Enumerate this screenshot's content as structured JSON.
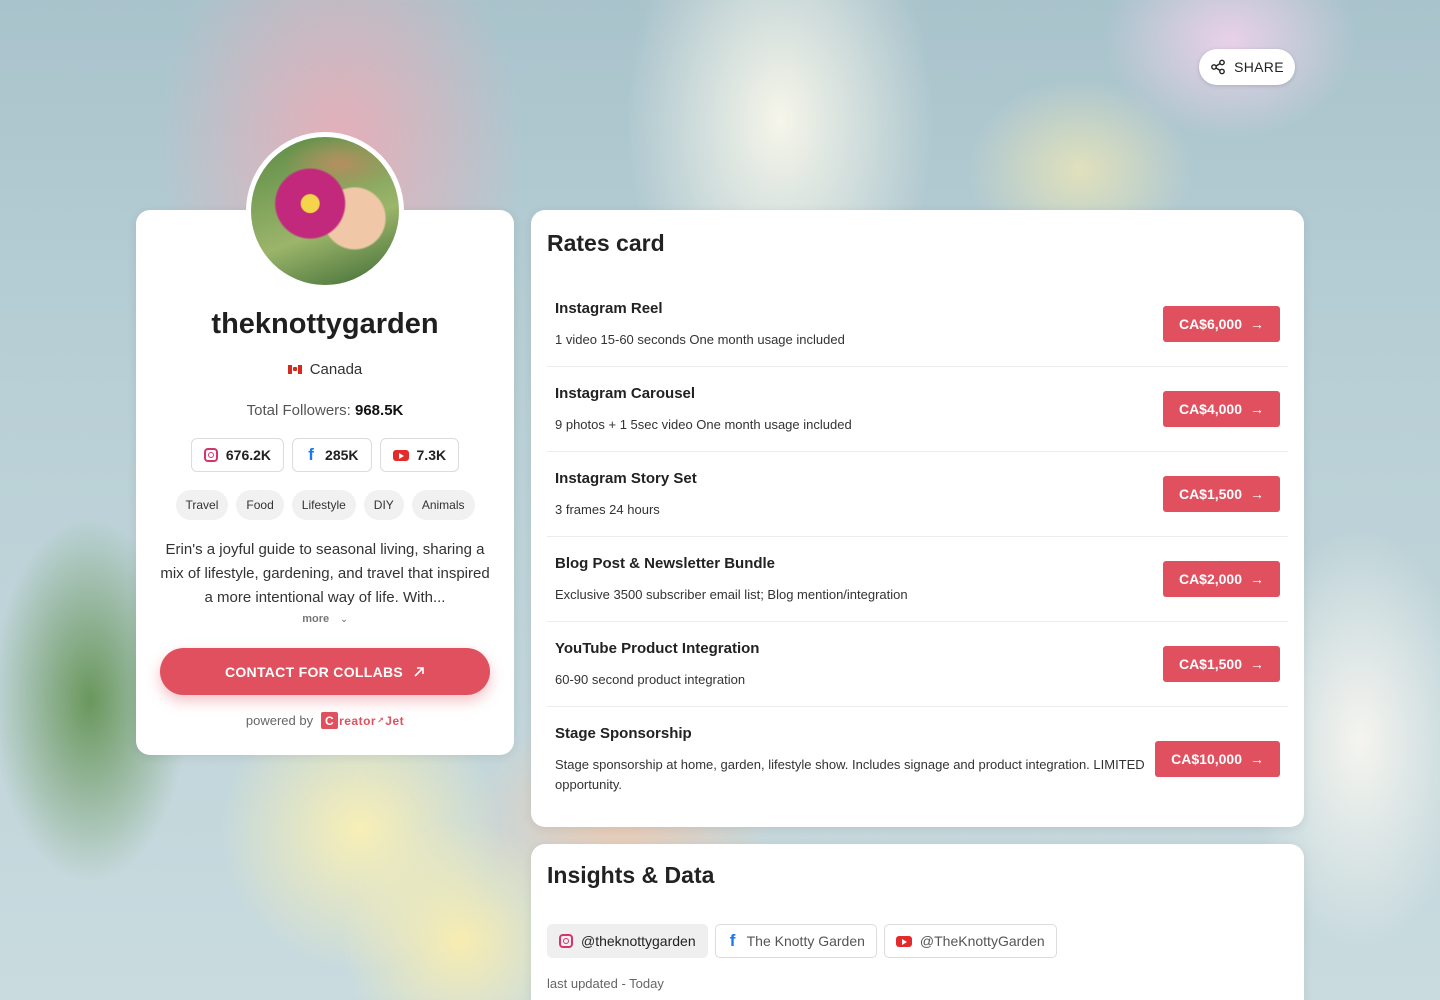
{
  "share": {
    "label": "SHARE"
  },
  "profile": {
    "username": "theknottygarden",
    "country": "Canada",
    "followers_label": "Total Followers:",
    "followers_value": "968.5K",
    "socials": [
      {
        "icon": "instagram-icon",
        "count": "676.2K"
      },
      {
        "icon": "facebook-icon",
        "count": "285K"
      },
      {
        "icon": "youtube-icon",
        "count": "7.3K"
      }
    ],
    "tags": [
      "Travel",
      "Food",
      "Lifestyle",
      "DIY",
      "Animals"
    ],
    "bio": "Erin's a joyful guide to seasonal living, sharing a mix of lifestyle, gardening, and travel that inspired a more intentional way of life. With...",
    "more_label": "more",
    "contact_label": "CONTACT FOR COLLABS",
    "powered_by": "powered by",
    "logo_text": "reator",
    "logo_text_2": "Jet",
    "logo_letter": "C"
  },
  "rates": {
    "title": "Rates card",
    "items": [
      {
        "name": "Instagram Reel",
        "desc": "1 video 15-60 seconds One month usage included",
        "price": "CA$6,000"
      },
      {
        "name": "Instagram Carousel",
        "desc": "9 photos + 1 5sec video One month usage included",
        "price": "CA$4,000"
      },
      {
        "name": "Instagram Story Set",
        "desc": "3 frames 24 hours",
        "price": "CA$1,500"
      },
      {
        "name": "Blog Post & Newsletter Bundle",
        "desc": "Exclusive 3500 subscriber email list; Blog mention/integration",
        "price": "CA$2,000"
      },
      {
        "name": "YouTube Product Integration",
        "desc": "60-90 second product integration",
        "price": "CA$1,500"
      },
      {
        "name": "Stage Sponsorship",
        "desc": "Stage sponsorship at home, garden, lifestyle show. Includes signage and product integration. LIMITED opportunity.",
        "price": "CA$10,000"
      }
    ]
  },
  "insights": {
    "title": "Insights & Data",
    "tabs": [
      {
        "icon": "instagram-icon",
        "label": "@theknottygarden"
      },
      {
        "icon": "facebook-icon",
        "label": "The Knotty Garden"
      },
      {
        "icon": "youtube-icon",
        "label": "@TheKnottyGarden"
      }
    ],
    "updated": "last updated - Today"
  },
  "colors": {
    "accent": "#e0505e",
    "instagram": "#d6336c",
    "facebook": "#1877f2",
    "youtube": "#e32b2b"
  }
}
